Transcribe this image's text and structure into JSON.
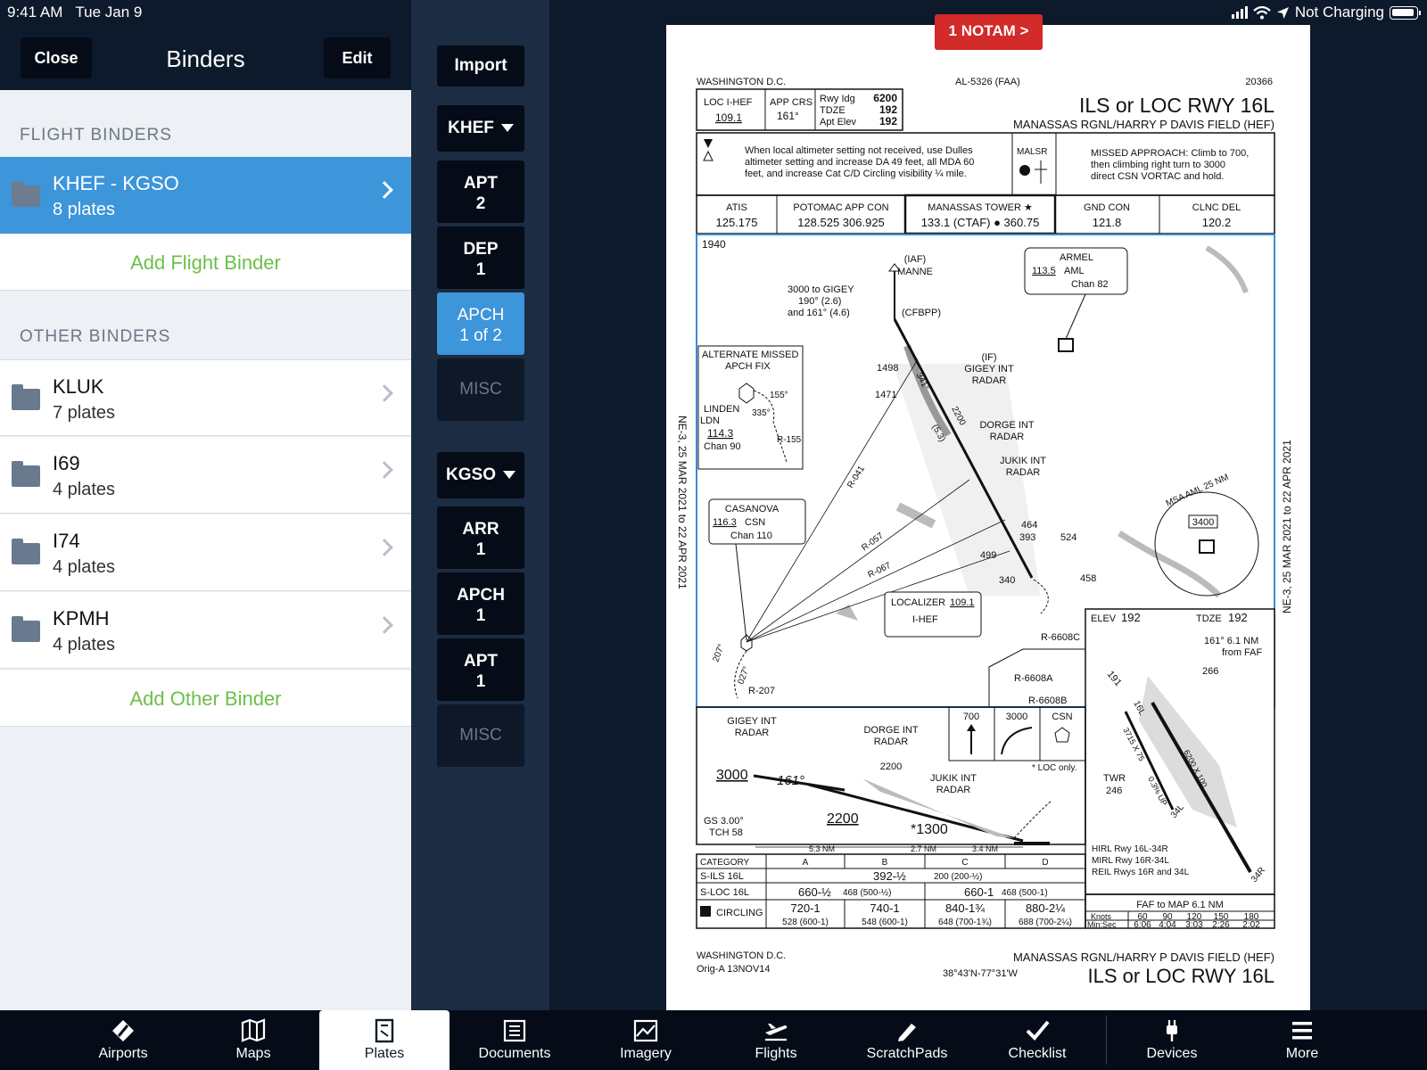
{
  "status_bar": {
    "time": "9:41 AM",
    "date": "Tue Jan 9",
    "battery_text": "Not Charging"
  },
  "binders": {
    "title": "Binders",
    "close_label": "Close",
    "edit_label": "Edit",
    "flight_section": "FLIGHT BINDERS",
    "flight_items": [
      {
        "name": "KHEF - KGSO",
        "count": "8 plates"
      }
    ],
    "add_flight": "Add Flight Binder",
    "other_section": "OTHER BINDERS",
    "other_items": [
      {
        "name": "KLUK",
        "count": "7 plates"
      },
      {
        "name": "I69",
        "count": "4 plates"
      },
      {
        "name": "I74",
        "count": "4 plates"
      },
      {
        "name": "KPMH",
        "count": "4 plates"
      }
    ],
    "add_other": "Add Other Binder"
  },
  "categories": {
    "import": "Import",
    "group1": {
      "airport": "KHEF",
      "items": [
        [
          "APT",
          "2"
        ],
        [
          "DEP",
          "1"
        ],
        [
          "APCH",
          "1 of 2"
        ],
        [
          "MISC",
          ""
        ]
      ]
    },
    "group2": {
      "airport": "KGSO",
      "items": [
        [
          "ARR",
          "1"
        ],
        [
          "APCH",
          "1"
        ],
        [
          "APT",
          "1"
        ],
        [
          "MISC",
          ""
        ]
      ]
    }
  },
  "notam": "1 NOTAM >",
  "plate": {
    "city": "WASHINGTON D.C.",
    "chart_id": "AL-5326 (FAA)",
    "chart_num": "20366",
    "title": "ILS or LOC RWY 16L",
    "airport": "MANASSAS RGNL/HARRY P DAVIS FIELD (HEF)",
    "loc_label": "LOC I-HEF",
    "loc_freq": "109.1",
    "app_crs_label": "APP CRS",
    "app_crs": "161°",
    "rwy_ldg": "Rwy Idg",
    "rwy_ldg_val": "6200",
    "tdze": "TDZE",
    "tdze_val": "192",
    "apt_elev": "Apt Elev",
    "apt_elev_val": "192",
    "note1": "When local altimeter setting not received, use Dulles",
    "note2": "altimeter setting and increase DA 49 feet, all MDA 60",
    "note3": "feet, and increase Cat C/D Circling visibility ¼ mile.",
    "malsr": "MALSR",
    "missed1": "MISSED APPROACH: Climb to 700,",
    "missed2": "then climbing right turn to 3000",
    "missed3": "direct CSN VORTAC and hold.",
    "comms": [
      {
        "name": "ATIS",
        "freq": "125.175"
      },
      {
        "name": "POTOMAC APP CON",
        "freq": "128.525  306.925"
      },
      {
        "name": "MANASSAS TOWER ★",
        "freq": "133.1 (CTAF) ● 360.75"
      },
      {
        "name": "GND CON",
        "freq": "121.8"
      },
      {
        "name": "CLNC DEL",
        "freq": "120.2"
      }
    ],
    "side_text": "NE-3, 25 MAR 2021 to 22 APR 2021",
    "fix_labels": {
      "elev1940": "1940",
      "manne": "(IAF)",
      "manne2": "MANNE",
      "cfbpp": "(CFBPP)",
      "gigey_tr": "3000 to GIGEY",
      "gigey_tr2": "190° (2.6)",
      "gigey_tr3": "and 161° (4.6)",
      "armel": "ARMEL",
      "armel_freq": "113.5",
      "armel_id": "AML",
      "armel_chan": "Chan 82",
      "alt_missed": "ALTERNATE MISSED",
      "alt_missed2": "APCH FIX",
      "linden": "LINDEN",
      "ldn": "LDN",
      "ldn_freq": "114.3",
      "ldn_chan": "Chan 90",
      "gigey_if": "(IF)",
      "gigey_if2": "GIGEY INT",
      "gigey_if3": "RADAR",
      "dorge": "DORGE INT",
      "dorge2": "RADAR",
      "jukik": "JUKIK INT",
      "jukik2": "RADAR",
      "casanova": "CASANOVA",
      "csn_freq": "116.3",
      "csn_id": "CSN",
      "csn_chan": "Chan 110",
      "r041": "R-041",
      "r057": "R-057",
      "r067": "R-067",
      "r155": "R-155",
      "r207": "R-207",
      "loc_box": "LOCALIZER",
      "loc_box_freq": "109.1",
      "loc_box_id": "I-HEF",
      "msa": "MSA AML 25 NM",
      "msa_alt": "3400",
      "r6608c": "R-6608C",
      "r6608a": "R-6608A",
      "r6608b": "R-6608B",
      "e1498": "1498",
      "e1471": "1471",
      "e464": "464",
      "e393": "393",
      "e524": "524",
      "e499": "499",
      "e340": "340",
      "e458": "458",
      "d2200": "2200",
      "d53": "(5.3)",
      "d341": "341°",
      "d155": "155°",
      "d335": "335°",
      "d207": "207°",
      "d027": "027°"
    },
    "profile": {
      "gigey": "GIGEY INT",
      "gigey2": "RADAR",
      "dorge": "DORGE INT",
      "dorge2": "RADAR",
      "dorge_alt": "2200",
      "jukik": "JUKIK INT",
      "jukik2": "RADAR",
      "alt3000": "3000",
      "crs161": "161°",
      "alt2200": "2200",
      "alt1300": "*1300",
      "gs": "GS 3.00°",
      "tch": "TCH 58",
      "loc_only": "* LOC only.",
      "d53": "5.3 NM",
      "d27": "2.7 NM",
      "d34": "3.4 NM",
      "ma700": "700",
      "ma3000": "3000",
      "macsn": "CSN"
    },
    "minima": {
      "header": [
        "CATEGORY",
        "A",
        "B",
        "C",
        "D"
      ],
      "sils": [
        "S-ILS 16L",
        "392-½",
        "200 (200-½)"
      ],
      "sloc": [
        "S-LOC 16L",
        "660-½",
        "468 (500-½)",
        "660-1",
        "468 (500-1)"
      ],
      "circ": [
        "CIRCLING",
        "720-1",
        "528 (600-1)",
        "740-1",
        "548 (600-1)",
        "840-1¾",
        "648 (700-1¾)",
        "880-2¼",
        "688 (700-2¼)"
      ]
    },
    "airport_diag": {
      "elev": "ELEV",
      "elev_val": "192",
      "tdze": "TDZE",
      "tdze_val": "192",
      "faf": "161° 6.1 NM",
      "faf2": "from FAF",
      "e266": "266",
      "twr": "TWR",
      "twr_val": "246",
      "r16l": "16L",
      "r34l": "34L",
      "r34r": "34R",
      "rwy_dim": "3715 X 75",
      "rwy_dim2": "6200 X 100",
      "rwy_up": "0.3% UP",
      "e191": "191",
      "hirl": "HIRL Rwy 16L-34R",
      "mirl": "MIRL Rwy 16R-34L",
      "reil": "REIL Rwys 16R and 34L"
    },
    "faf_map": {
      "title": "FAF to MAP  6.1 NM",
      "knots_label": "Knots",
      "knots": [
        "60",
        "90",
        "120",
        "150",
        "180"
      ],
      "minsec_label": "Min:Sec",
      "times": [
        "6:06",
        "4:04",
        "3:03",
        "2:26",
        "2:02"
      ]
    },
    "footer_city": "WASHINGTON D.C.",
    "footer_orig": "Orig-A  13NOV14",
    "footer_coords": "38°43'N-77°31'W",
    "footer_airport": "MANASSAS RGNL/HARRY P DAVIS FIELD (HEF)",
    "footer_title": "ILS or LOC RWY 16L"
  },
  "tabs": [
    {
      "label": "Airports",
      "icon": "airports-icon"
    },
    {
      "label": "Maps",
      "icon": "maps-icon"
    },
    {
      "label": "Plates",
      "icon": "plates-icon"
    },
    {
      "label": "Documents",
      "icon": "documents-icon"
    },
    {
      "label": "Imagery",
      "icon": "imagery-icon"
    },
    {
      "label": "Flights",
      "icon": "flights-icon"
    },
    {
      "label": "ScratchPads",
      "icon": "scratchpads-icon"
    },
    {
      "label": "Checklist",
      "icon": "checklist-icon"
    },
    {
      "label": "Devices",
      "icon": "devices-icon"
    },
    {
      "label": "More",
      "icon": "more-icon"
    }
  ],
  "colors": {
    "accent": "#3d95da",
    "add_green": "#6cc04a",
    "notam_red": "#d32a2a",
    "dark": "#0d1a2b"
  }
}
